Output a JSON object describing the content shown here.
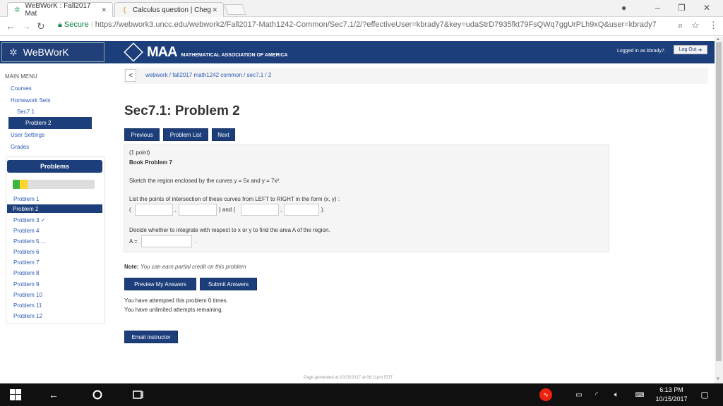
{
  "browser": {
    "tabs": [
      {
        "title": "WeBWorK : Fall2017 Mat"
      },
      {
        "title": "Calculus question | Cheg"
      }
    ],
    "url": "https://webwork3.uncc.edu/webwork2/Fall2017-Math1242-Common/Sec7.1/2/?effectiveUser=kbrady7&key=udaStrD7935fkt79FsQWq7ggUrPLh9xQ&user=kbrady7",
    "secure_label": "Secure"
  },
  "header": {
    "logo_text": "WeBWorK",
    "maa_big": "MAA",
    "maa_sub": "MATHEMATICAL ASSOCIATION OF AMERICA",
    "logged_in": "Logged in as kbrady7.",
    "logout_label": "Log Out"
  },
  "sidebar": {
    "main_menu": "MAIN MENU",
    "courses": "Courses",
    "homework_sets": "Homework Sets",
    "sec71": "Sec7.1",
    "problem2": "Problem 2",
    "user_settings": "User Settings",
    "grades": "Grades",
    "problems_heading": "Problems",
    "problem_list": [
      "Problem 1",
      "Problem 2",
      "Problem 3 ✓",
      "Problem 4",
      "Problem 5 ...",
      "Problem 6",
      "Problem 7",
      "Problem 8",
      "Problem 9",
      "Problem 10",
      "Problem 11",
      "Problem 12"
    ]
  },
  "main": {
    "breadcrumb": "webwork / fall2017 math1242 common / sec7.1 / 2",
    "title": "Sec7.1: Problem 2",
    "nav_buttons": {
      "previous": "Previous",
      "problem_list": "Problem List",
      "next": "Next"
    },
    "points": "(1 point)",
    "book_problem": "Book Problem 7",
    "sketch_text": "Sketch the region enclosed by the curves y = 5x and y = 7x².",
    "list_text": "List the points of intersection of these curves from LEFT to RIGHT in the form (x, y) :",
    "paren_open": "(",
    "comma": ",",
    "and_text": ") and (",
    "paren_close": ").",
    "decide_text": "Decide whether to integrate with respect to x or y to find the area A of the region.",
    "a_label": "A =",
    "period": ".",
    "note_label": "Note:",
    "note_text": "You can earn partial credit on this problem",
    "preview_label": "Preview My Answers",
    "submit_label": "Submit Answers",
    "attempted": "You have attempted this problem 0 times.",
    "remaining": "You have unlimited attempts remaining.",
    "email_label": "Email instructor",
    "footer": "Page generated at 10/15/2017 at 06:11pm EDT"
  },
  "taskbar": {
    "time": "6:13 PM",
    "date": "10/15/2017"
  }
}
